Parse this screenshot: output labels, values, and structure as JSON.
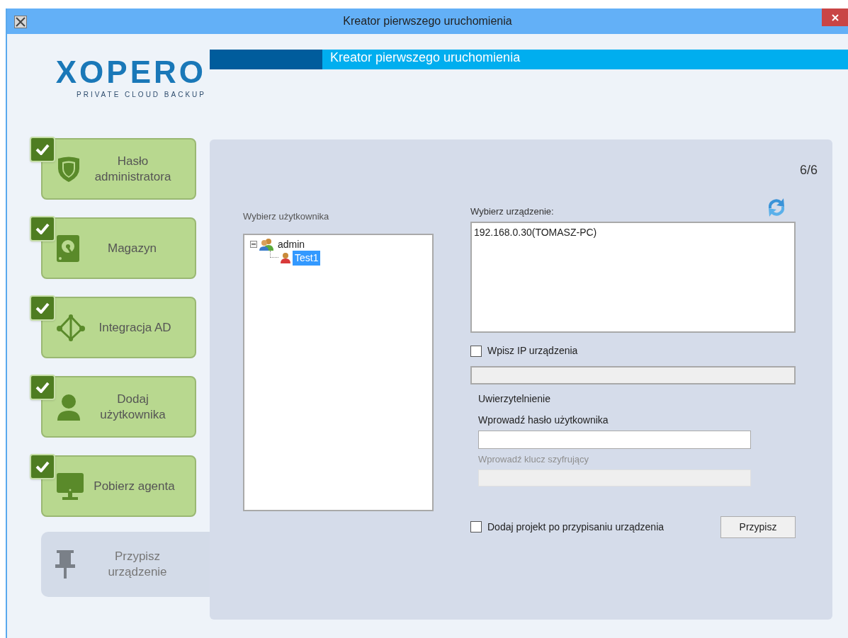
{
  "window": {
    "title": "Kreator pierwszego uruchomienia"
  },
  "logo": {
    "name": "XOPERO",
    "tagline": "PRIVATE CLOUD BACKUP"
  },
  "banner": {
    "title": "Kreator pierwszego uruchomienia"
  },
  "steps": [
    {
      "label": "Hasło administratora",
      "completed": true,
      "selected": false
    },
    {
      "label": "Magazyn",
      "completed": true,
      "selected": false
    },
    {
      "label": "Integracja AD",
      "completed": true,
      "selected": false
    },
    {
      "label": "Dodaj użytkownika",
      "completed": true,
      "selected": false
    },
    {
      "label": "Pobierz agenta",
      "completed": true,
      "selected": false
    },
    {
      "label": "Przypisz urządzenie",
      "completed": false,
      "selected": true
    }
  ],
  "counter": "6/6",
  "users": {
    "label": "Wybierz użytkownika",
    "tree": [
      {
        "label": "admin",
        "expanded": true,
        "selected": false,
        "children": [
          {
            "label": "Test1",
            "selected": true
          }
        ]
      }
    ]
  },
  "devices": {
    "label": "Wybierz urządzenie:",
    "items": [
      {
        "label": "192.168.0.30(TOMASZ-PC)",
        "selected": false
      }
    ]
  },
  "manual_ip": {
    "label": "Wpisz IP urządzenia",
    "checked": false
  },
  "auth": {
    "title": "Uwierzytelnienie",
    "password_label": "Wprowadź hasło użytkownika",
    "key_label": "Wprowadź klucz szyfrujący",
    "key_disabled": true
  },
  "add_project": {
    "label": "Dodaj projekt po przypisaniu urządzenia",
    "checked": false
  },
  "assign_button": "Przypisz"
}
